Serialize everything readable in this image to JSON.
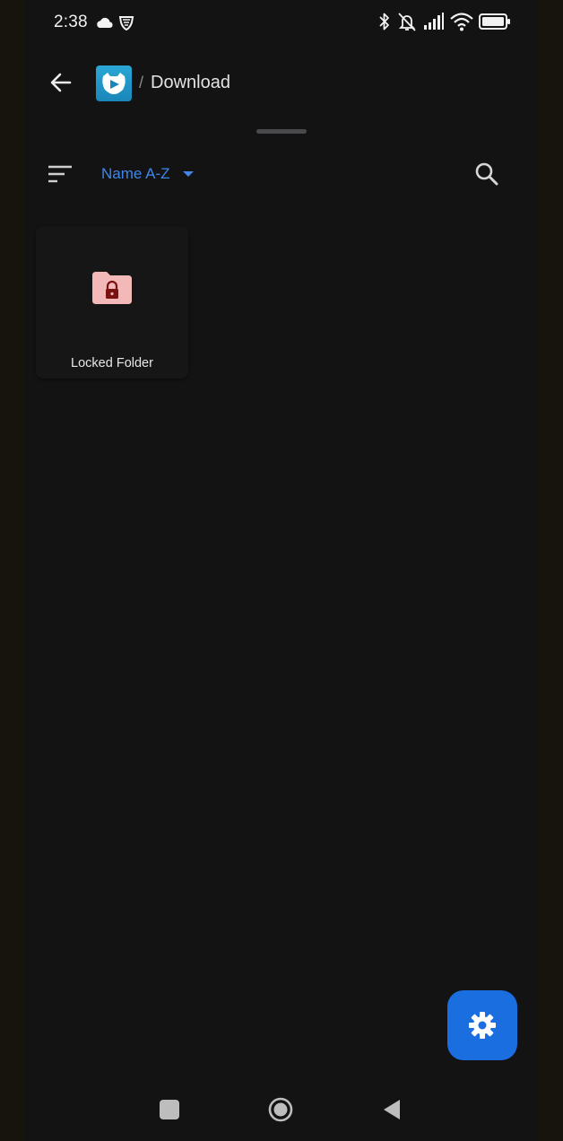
{
  "status_bar": {
    "time": "2:38",
    "left_icons": [
      "cloud-icon",
      "vpn-shield-icon"
    ],
    "right_icons": [
      "bluetooth-icon",
      "bell-muted-icon",
      "signal-icon",
      "wifi-icon",
      "battery-icon"
    ]
  },
  "header": {
    "back_icon": "arrow-left-icon",
    "app_logo": "app-logo",
    "breadcrumb_separator": "/",
    "current_folder": "Download"
  },
  "toolbar": {
    "sort_icon": "sort-lines-icon",
    "sort_label": "Name A-Z",
    "sort_dropdown_icon": "caret-down-icon",
    "search_icon": "search-icon"
  },
  "folders": [
    {
      "label": "Locked Folder",
      "icon": "locked-folder-icon"
    }
  ],
  "fab": {
    "icon": "gear-icon"
  },
  "nav_bar": {
    "icons": [
      "recents-square-icon",
      "home-circle-icon",
      "back-triangle-icon"
    ]
  },
  "colors": {
    "background": "#131314",
    "accent": "#3f86e8",
    "fab": "#1a6ee0",
    "folder_pink": "#f3b8b8",
    "lock": "#7a1212"
  }
}
